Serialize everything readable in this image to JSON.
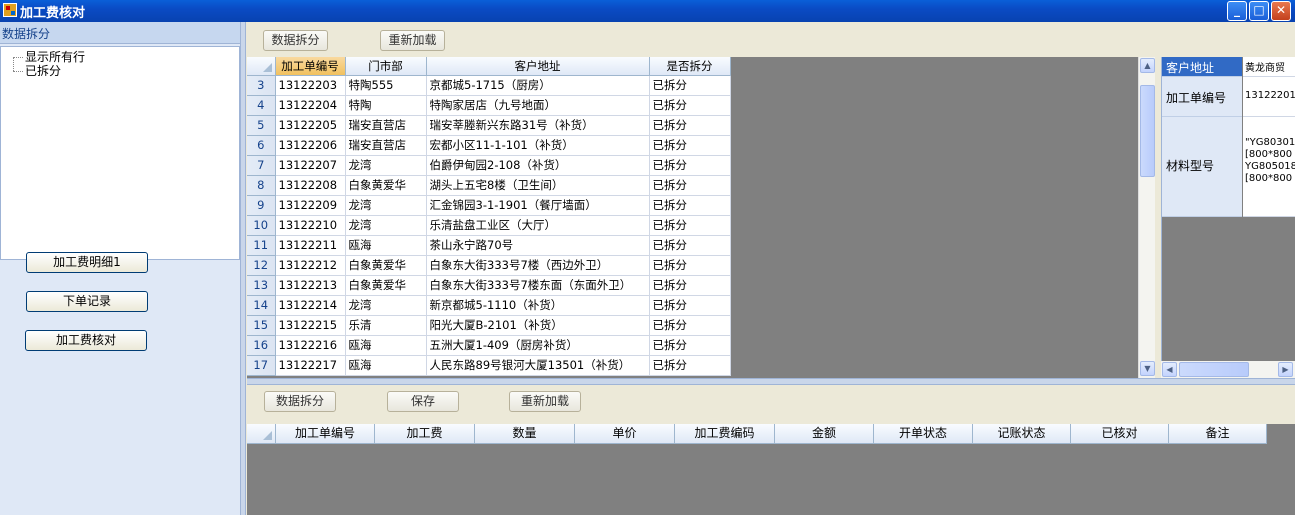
{
  "window": {
    "title": "加工费核对",
    "buttons": {
      "minimize": "_",
      "maximize": "□",
      "close": "✕"
    }
  },
  "sidebar": {
    "header": "数据拆分",
    "tree": [
      "显示所有行",
      "已拆分"
    ],
    "buttons": [
      "加工费明细1",
      "下单记录",
      "加工费核对"
    ]
  },
  "top_toolbar": {
    "split": "数据拆分",
    "reload": "重新加载"
  },
  "top_grid": {
    "columns": [
      "加工单编号",
      "门市部",
      "客户地址",
      "是否拆分"
    ],
    "rows": [
      {
        "n": "3",
        "id": "13122203",
        "store": "特陶555",
        "addr": "京都城5-1715（厨房）",
        "split": "已拆分"
      },
      {
        "n": "4",
        "id": "13122204",
        "store": "特陶",
        "addr": "特陶家居店（九号地面）",
        "split": "已拆分"
      },
      {
        "n": "5",
        "id": "13122205",
        "store": "瑞安直营店",
        "addr": "瑞安莘塍新兴东路31号（补货）",
        "split": "已拆分"
      },
      {
        "n": "6",
        "id": "13122206",
        "store": "瑞安直营店",
        "addr": "宏都小区11-1-101（补货）",
        "split": "已拆分"
      },
      {
        "n": "7",
        "id": "13122207",
        "store": "龙湾",
        "addr": "伯爵伊甸园2-108（补货）",
        "split": "已拆分"
      },
      {
        "n": "8",
        "id": "13122208",
        "store": "白象黄爱华",
        "addr": "湖头上五宅8楼（卫生间）",
        "split": "已拆分"
      },
      {
        "n": "9",
        "id": "13122209",
        "store": "龙湾",
        "addr": "汇金锦园3-1-1901（餐厅墙面）",
        "split": "已拆分"
      },
      {
        "n": "10",
        "id": "13122210",
        "store": "龙湾",
        "addr": "乐清盐盘工业区（大厅）",
        "split": "已拆分"
      },
      {
        "n": "11",
        "id": "13122211",
        "store": "瓯海",
        "addr": "茶山永宁路70号",
        "split": "已拆分"
      },
      {
        "n": "12",
        "id": "13122212",
        "store": "白象黄爱华",
        "addr": "白象东大街333号7楼（西边外卫）",
        "split": "已拆分"
      },
      {
        "n": "13",
        "id": "13122213",
        "store": "白象黄爱华",
        "addr": "白象东大街333号7楼东面（东面外卫）",
        "split": "已拆分"
      },
      {
        "n": "14",
        "id": "13122214",
        "store": "龙湾",
        "addr": "新京都城5-1110（补货）",
        "split": "已拆分"
      },
      {
        "n": "15",
        "id": "13122215",
        "store": "乐清",
        "addr": "阳光大厦B-2101（补货）",
        "split": "已拆分"
      },
      {
        "n": "16",
        "id": "13122216",
        "store": "瓯海",
        "addr": "五洲大厦1-409（厨房补货）",
        "split": "已拆分"
      },
      {
        "n": "17",
        "id": "13122217",
        "store": "瓯海",
        "addr": "人民东路89号银河大厦13501（补货）",
        "split": "已拆分"
      }
    ]
  },
  "detail_panel": {
    "rows": [
      {
        "label": "客户地址",
        "value": "黄龙商贸"
      },
      {
        "label": "加工单编号",
        "value": "13122201"
      },
      {
        "label": "材料型号",
        "value": "\"YG80301\n[800*800\nYG805018\n[800*800"
      }
    ]
  },
  "bottom_toolbar": {
    "split": "数据拆分",
    "save": "保存",
    "reload": "重新加载"
  },
  "bottom_grid": {
    "columns": [
      "加工单编号",
      "加工费",
      "数量",
      "单价",
      "加工费编码",
      "金额",
      "开单状态",
      "记账状态",
      "已核对",
      "备注"
    ]
  }
}
